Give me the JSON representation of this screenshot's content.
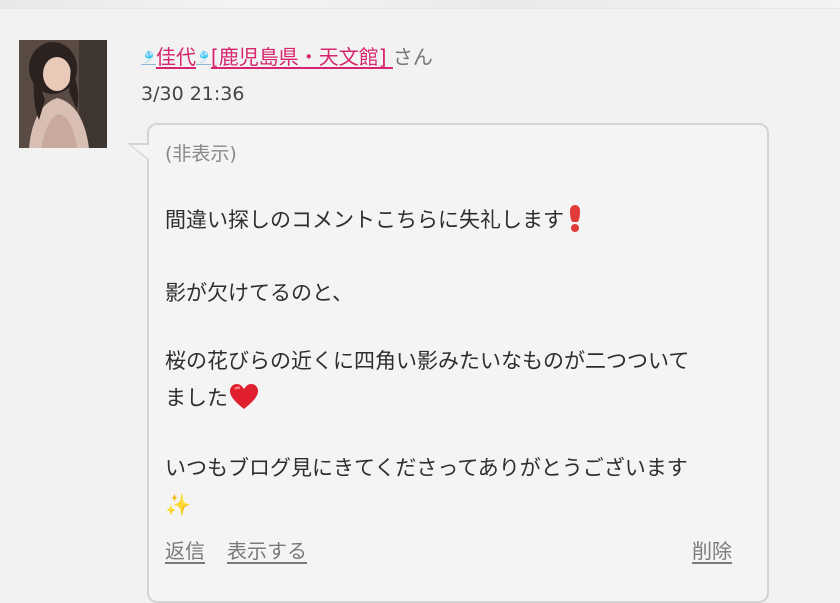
{
  "comment": {
    "author": {
      "deco_left": "🎐",
      "name": "佳代",
      "deco_right": "🎐",
      "shop": "[鹿児島県・天文館]",
      "suffix": "さん"
    },
    "timestamp": "3/30 21:36",
    "visibility_label": "(非表示)",
    "lines": [
      "間違い探しのコメントこちらに失礼します",
      "影が欠けてるのと、",
      "桜の花びらの近くに四角い影みたいなものが二つついて",
      "ました",
      "いつもブログ見にきてくださってありがとうございます",
      "✨"
    ],
    "emoji_line1": "red-exclamation-icon",
    "emoji_line4": "red-heart-icon",
    "emoji_line6": "sparkles-icon",
    "actions": {
      "reply": "返信",
      "show": "表示する",
      "delete": "削除"
    }
  },
  "colors": {
    "author_link": "#d6246e",
    "action_link": "#7a7a7a",
    "bubble_border": "#d4d4d4",
    "background": "#f2f2f2"
  }
}
